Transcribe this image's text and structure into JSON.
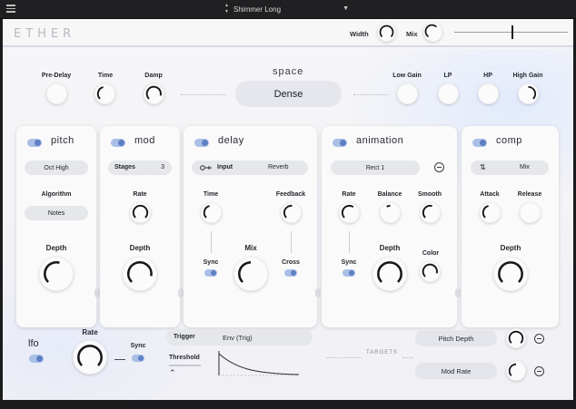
{
  "host": {
    "preset_name": "Shimmer Long"
  },
  "header": {
    "brand": "ETHER",
    "width_label": "Width",
    "mix_label": "Mix"
  },
  "space": {
    "title": "space",
    "mode": "Dense",
    "labels": {
      "predelay": "Pre-Delay",
      "time": "Time",
      "damp": "Damp",
      "lowgain": "Low Gain",
      "lp": "LP",
      "hp": "HP",
      "highgain": "High Gain"
    }
  },
  "modules": {
    "pitch": {
      "title": "pitch",
      "mode": "Oct High",
      "algorithm_label": "Algorithm",
      "algorithm": "Notes",
      "depth_label": "Depth"
    },
    "mod": {
      "title": "mod",
      "stages_label": "Stages",
      "stages_value": "3",
      "rate_label": "Rate",
      "depth_label": "Depth"
    },
    "delay": {
      "title": "delay",
      "input_label": "Input",
      "input_value": "Reverb",
      "time_label": "Time",
      "feedback_label": "Feedback",
      "sync_label": "Sync",
      "mix_label": "Mix",
      "cross_label": "Cross"
    },
    "animation": {
      "title": "animation",
      "shape": "Rect 1",
      "rate_label": "Rate",
      "balance_label": "Balance",
      "smooth_label": "Smooth",
      "sync_label": "Sync",
      "depth_label": "Depth",
      "color_label": "Color"
    },
    "comp": {
      "title": "comp",
      "mode": "Mix",
      "attack_label": "Attack",
      "release_label": "Release",
      "depth_label": "Depth"
    }
  },
  "lfo": {
    "title": "lfo",
    "rate_label": "Rate",
    "sync_label": "Sync",
    "trigger_label": "Trigger",
    "trigger_value": "Env (Trig)",
    "threshold_label": "Threshold",
    "targets_label": "TARGETS",
    "targets": [
      {
        "name": "Pitch Depth"
      },
      {
        "name": "Mod Rate"
      }
    ]
  },
  "colors": {
    "accent": "#5d7fc4",
    "knob_arc": "#16171b",
    "panel": "#fafafb"
  },
  "icons": [
    "menu-icon",
    "preset-stepper-icon",
    "dropdown-icon",
    "link-icon",
    "swap-icon",
    "minus-circle-icon",
    "chevron-up-icon"
  ]
}
